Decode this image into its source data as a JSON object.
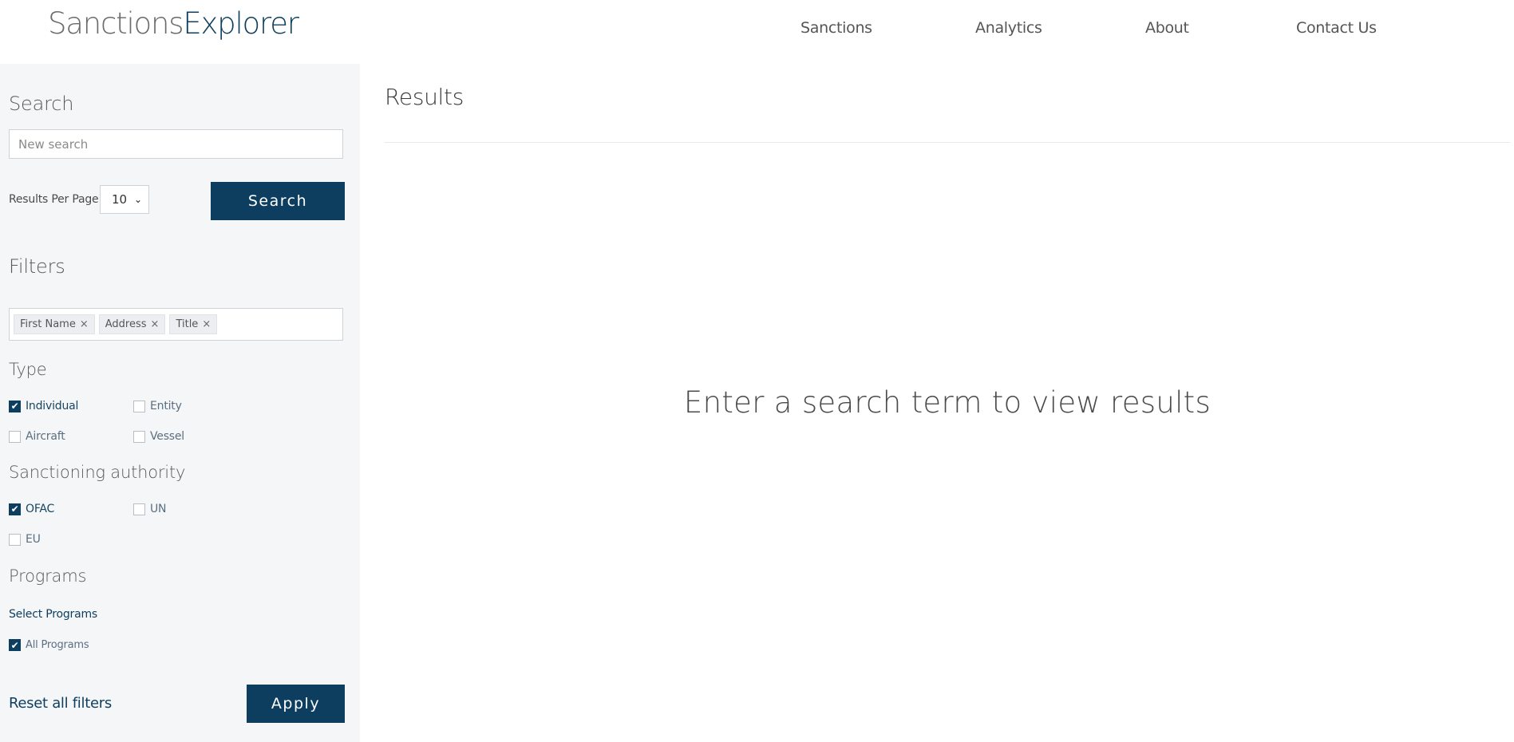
{
  "header": {
    "logo_part1": "Sanctions",
    "logo_part2": "Explorer",
    "nav": [
      "Sanctions",
      "Analytics",
      "About",
      "Contact Us"
    ]
  },
  "sidebar": {
    "search_heading": "Search",
    "search_placeholder": "New search",
    "results_per_page_label": "Results Per Page",
    "results_per_page_value": "10",
    "search_button": "Search",
    "filters_heading": "Filters",
    "filter_tags": [
      "First Name",
      "Address",
      "Title"
    ],
    "type_heading": "Type",
    "type_options": [
      {
        "label": "Individual",
        "checked": true
      },
      {
        "label": "Entity",
        "checked": false
      },
      {
        "label": "Aircraft",
        "checked": false
      },
      {
        "label": "Vessel",
        "checked": false
      }
    ],
    "authority_heading": "Sanctioning authority",
    "authority_options": [
      {
        "label": "OFAC",
        "checked": true
      },
      {
        "label": "UN",
        "checked": false
      },
      {
        "label": "EU",
        "checked": false
      }
    ],
    "programs_heading": "Programs",
    "select_programs_label": "Select Programs",
    "all_programs_label": "All Programs",
    "all_programs_checked": true,
    "reset_label": "Reset all filters",
    "apply_button": "Apply"
  },
  "results": {
    "title": "Results",
    "empty_message": "Enter a search term to view results"
  },
  "colors": {
    "brand": "#0d3e5f",
    "sidebar_bg": "#f5f6f8"
  }
}
